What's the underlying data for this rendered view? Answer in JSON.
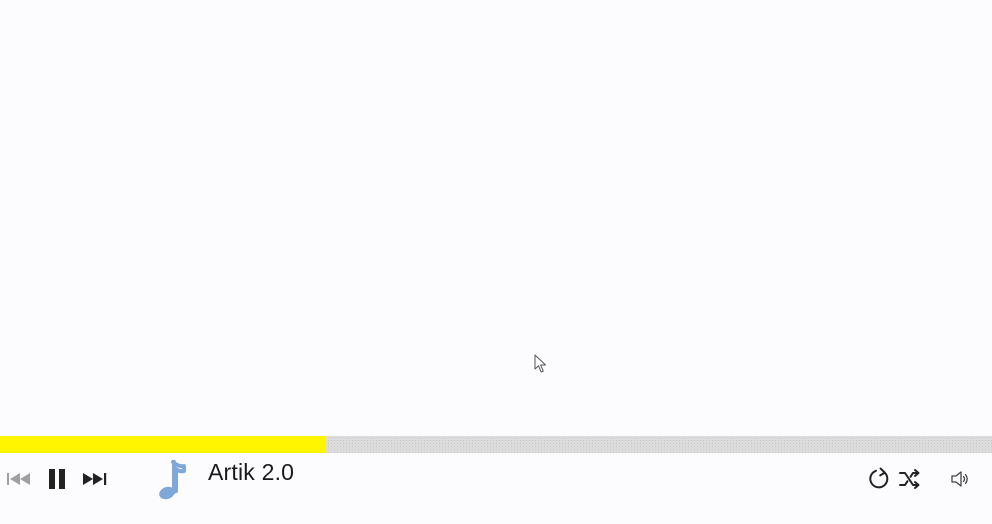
{
  "player": {
    "track_title": "Artik 2.0",
    "progress_fraction": 0.329,
    "state": "playing"
  },
  "colors": {
    "progress_fill": "#fff500",
    "progress_track": "#dcdcdc",
    "track_icon": "#7fa7d9",
    "control_active": "#222222",
    "control_disabled": "#a0a0a0"
  },
  "icons": {
    "previous": "skip-previous-icon",
    "pause": "pause-icon",
    "next": "skip-next-icon",
    "track": "music-note-icon",
    "repeat": "repeat-icon",
    "shuffle": "shuffle-icon",
    "volume": "volume-icon",
    "cursor": "mouse-cursor-icon"
  }
}
